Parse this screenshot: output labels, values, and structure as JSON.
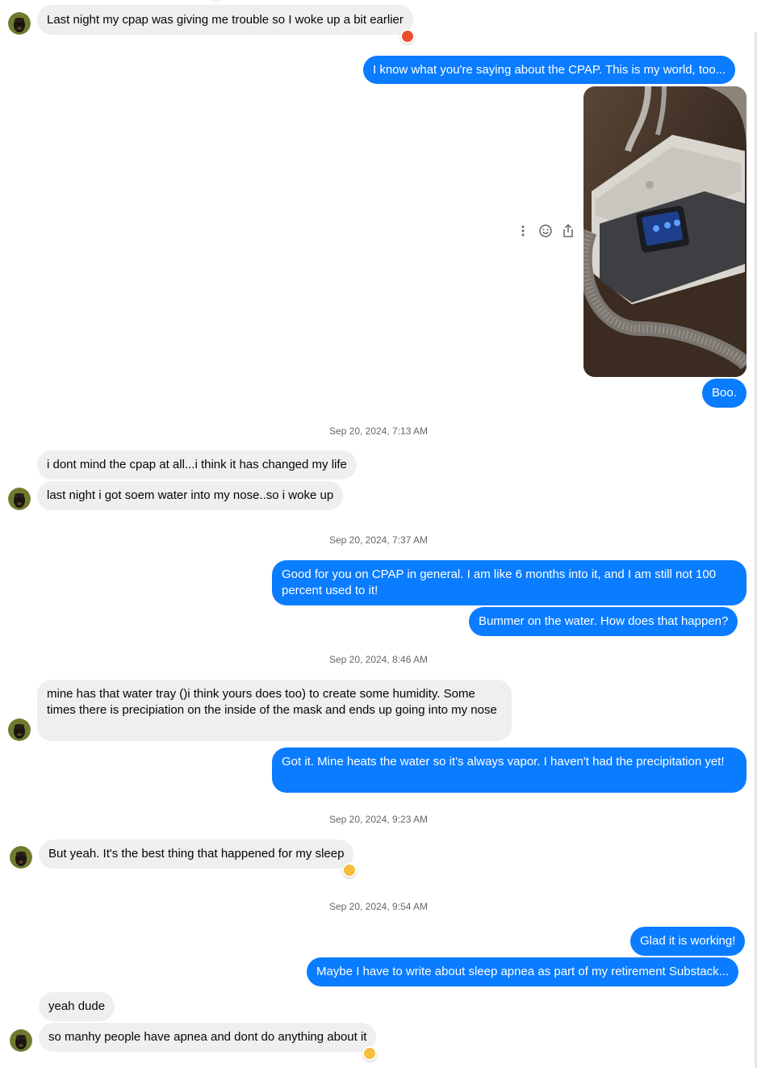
{
  "messages": [
    {
      "text": "Last night my cpap was giving me trouble so I woke up a bit earlier",
      "reaction": "angry-face-reaction"
    },
    {
      "text": "I know what you're saying about the CPAP.  This is my world, too..."
    },
    {
      "image": "cpap-machine-photo"
    },
    {
      "text": "Boo."
    },
    {
      "timestamp": "Sep 20, 2024, 7:13 AM"
    },
    {
      "text": "i dont mind the cpap at all...i think it has changed my life"
    },
    {
      "text": "last night i got soem water into my nose..so i woke up"
    },
    {
      "timestamp": "Sep 20, 2024, 7:37 AM"
    },
    {
      "text": "Good for you on CPAP in general.  I am like 6 months into it, and I am still not 100 percent used to it!"
    },
    {
      "text": "Bummer on the water.  How does that happen?"
    },
    {
      "timestamp": "Sep 20, 2024, 8:46 AM"
    },
    {
      "text": "mine has that water tray ()i think yours does too) to create some humidity. Some times there is precipiation on the inside of the mask and ends up going into my nose"
    },
    {
      "text": "Got it.  Mine heats the water so it's always vapor.  I haven't had the precipitation yet!"
    },
    {
      "timestamp": "Sep 20, 2024, 9:23 AM"
    },
    {
      "text": "But yeah. It's the best thing that happened for my sleep",
      "reaction": "thumbs-up-reaction"
    },
    {
      "timestamp": "Sep 20, 2024, 9:54 AM"
    },
    {
      "text": "Glad it is working!"
    },
    {
      "text": "Maybe I have to write about sleep apnea as part of my retirement Substack..."
    },
    {
      "text": "yeah dude"
    },
    {
      "text": "so manhy people have apnea and dont do anything about it",
      "reaction": "thumbs-up-reaction"
    }
  ],
  "message_actions": [
    "more-options-icon",
    "react-emoji-icon",
    "share-icon"
  ],
  "colors": {
    "outgoing_bubble": "#0a7cff",
    "incoming_bubble": "#efefef",
    "timestamp_text": "#65676b",
    "angry_reaction": "#e8502d",
    "thumbs_reaction": "#f4bf3a"
  }
}
